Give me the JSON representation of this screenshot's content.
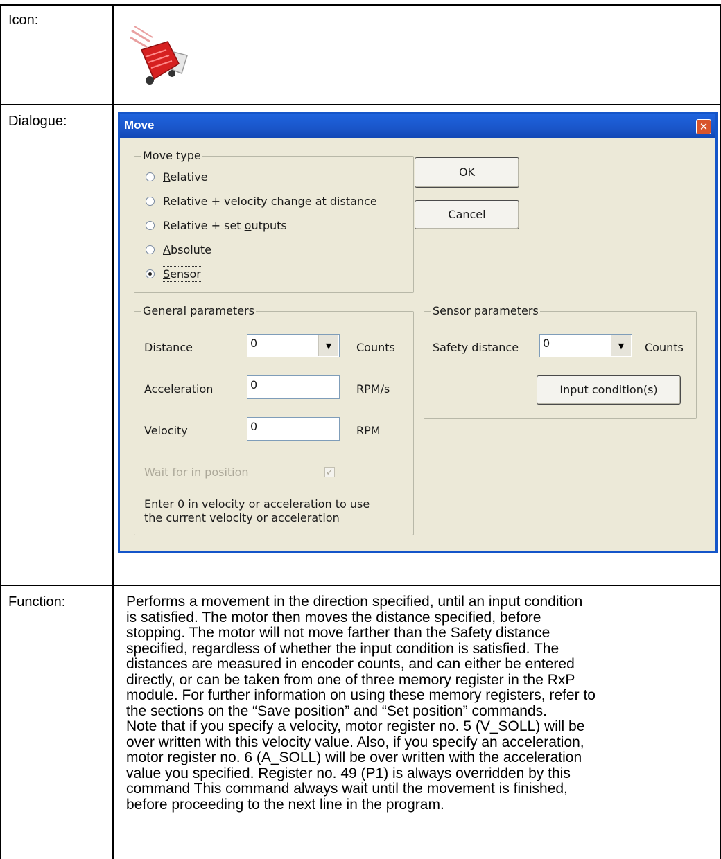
{
  "labels": {
    "icon": "Icon:",
    "dialogue": "Dialogue:",
    "function": "Function:"
  },
  "icon": {
    "name": "sensor-move-icon",
    "color": "#d62020"
  },
  "dialog": {
    "title": "Move",
    "close_glyph": "✕",
    "move_type": {
      "title": "Move type",
      "options": [
        {
          "pre": "",
          "u": "R",
          "post": "elative",
          "checked": false
        },
        {
          "pre": "Relative + ",
          "u": "v",
          "post": "elocity change at distance",
          "checked": false
        },
        {
          "pre": "Relative + set ",
          "u": "o",
          "post": "utputs",
          "checked": false
        },
        {
          "pre": "",
          "u": "A",
          "post": "bsolute",
          "checked": false
        },
        {
          "pre": "",
          "u": "S",
          "post": "ensor",
          "checked": true
        }
      ]
    },
    "buttons": {
      "ok": "OK",
      "cancel": "Cancel",
      "input_condition": "Input condition(s)"
    },
    "general": {
      "title": "General parameters",
      "distance_label": "Distance",
      "distance_value": "0",
      "distance_unit": "Counts",
      "acceleration_label": "Acceleration",
      "acceleration_value": "0",
      "acceleration_unit": "RPM/s",
      "velocity_label": "Velocity",
      "velocity_value": "0",
      "velocity_unit": "RPM",
      "wait_label": "Wait for in position",
      "wait_checked": true,
      "note_line1": "Enter 0 in velocity or acceleration to use",
      "note_line2": "the current velocity or acceleration"
    },
    "sensor": {
      "title": "Sensor parameters",
      "safety_label": "Safety distance",
      "safety_value": "0",
      "safety_unit": "Counts"
    }
  },
  "function_lines": [
    "Performs a movement in the direction specified, until an input condition",
    "is satisfied. The motor then moves the distance specified, before",
    "stopping. The motor will not move farther than the Safety distance",
    "specified, regardless of whether the input condition is satisfied. The",
    "distances are measured in encoder counts, and can either be entered",
    "directly, or can be taken from one of three memory register in the RxP",
    "module. For further information on using these memory registers, refer to",
    "the sections on the “Save position” and “Set position” commands.",
    "Note that if you specify a velocity, motor register no. 5 (V_SOLL) will be",
    "over written with this velocity value. Also, if you specify an acceleration,",
    "motor register no. 6 (A_SOLL) will be over written with the acceleration",
    "value you specified. Register no. 49 (P1) is always overridden by this",
    "command This command always wait until the movement is finished,",
    "before proceeding to the next line in the program."
  ]
}
